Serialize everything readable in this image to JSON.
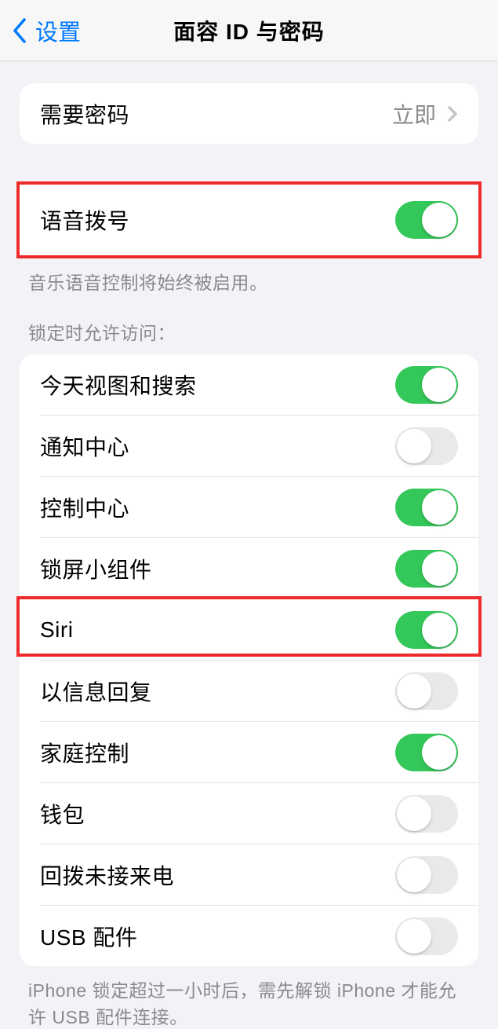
{
  "nav": {
    "back_label": "设置",
    "title": "面容 ID 与密码"
  },
  "require_passcode": {
    "label": "需要密码",
    "value": "立即"
  },
  "voice_dial": {
    "label": "语音拨号",
    "enabled": true,
    "footer": "音乐语音控制将始终被启用。"
  },
  "allow_access": {
    "header": "锁定时允许访问：",
    "items": [
      {
        "label": "今天视图和搜索",
        "enabled": true
      },
      {
        "label": "通知中心",
        "enabled": false
      },
      {
        "label": "控制中心",
        "enabled": true
      },
      {
        "label": "锁屏小组件",
        "enabled": true
      },
      {
        "label": "Siri",
        "enabled": true
      },
      {
        "label": "以信息回复",
        "enabled": false
      },
      {
        "label": "家庭控制",
        "enabled": true
      },
      {
        "label": "钱包",
        "enabled": false
      },
      {
        "label": "回拨未接来电",
        "enabled": false
      },
      {
        "label": "USB 配件",
        "enabled": false
      }
    ],
    "footer": "iPhone 锁定超过一小时后，需先解锁 iPhone 才能允许 USB 配件连接。"
  }
}
